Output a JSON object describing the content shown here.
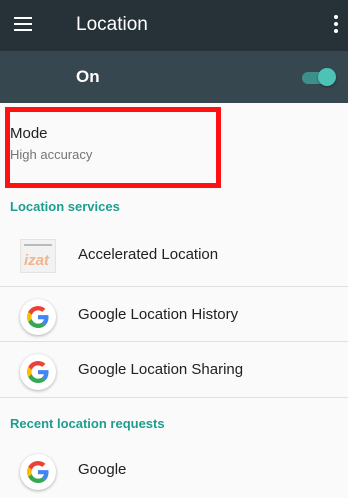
{
  "app_bar": {
    "title": "Location",
    "menu_icon": "hamburger-menu-icon",
    "overflow_icon": "more-vert-icon",
    "background": "#263238"
  },
  "master_switch": {
    "label": "On",
    "checked": true,
    "background": "#37474f",
    "accent": "#4cc3b5"
  },
  "mode": {
    "title": "Mode",
    "summary": "High accuracy",
    "highlight_color": "#ff1111"
  },
  "location_services": {
    "header": "Location services",
    "items": [
      {
        "label": "Accelerated Location",
        "icon": "izat-icon"
      },
      {
        "label": "Google Location History",
        "icon": "google-g-icon"
      },
      {
        "label": "Google Location Sharing",
        "icon": "google-g-icon"
      }
    ]
  },
  "recent_requests": {
    "header": "Recent location requests",
    "items": [
      {
        "label": "Google",
        "icon": "google-g-icon"
      }
    ]
  },
  "colors": {
    "category_header": "#1e9e8f",
    "google_blue": "#4285F4",
    "google_red": "#EA4335",
    "google_yellow": "#FBBC05",
    "google_green": "#34A853"
  }
}
